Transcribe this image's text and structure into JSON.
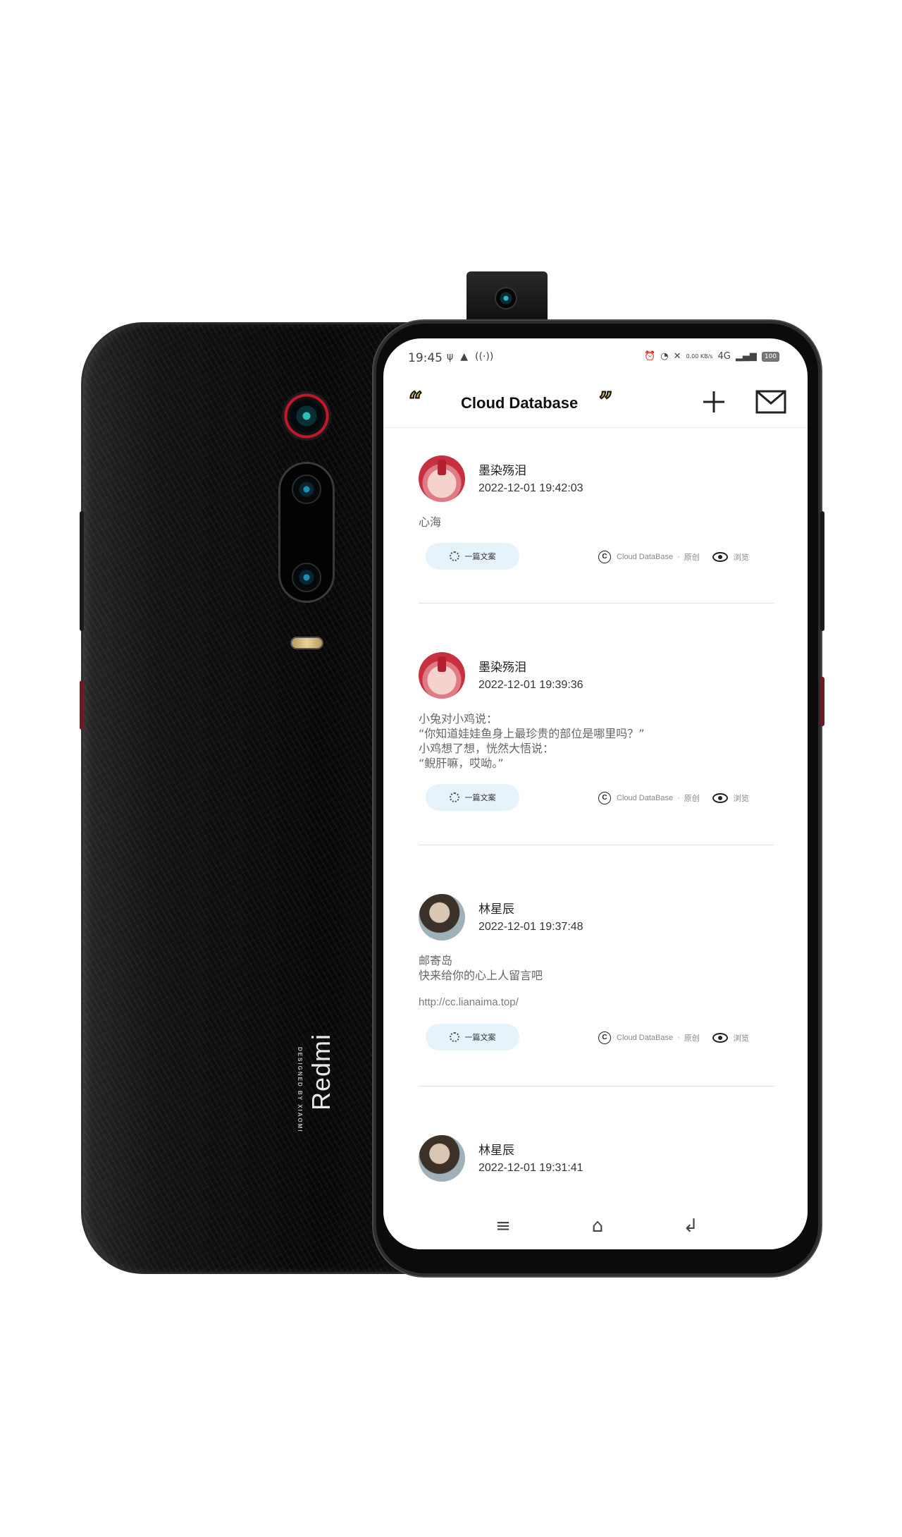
{
  "device": {
    "brand": "Redmi",
    "designed_by": "DESIGNED BY XIAOMI"
  },
  "status_bar": {
    "time": "19:45",
    "net_speed": "0.00 KB/s",
    "network": "4G",
    "battery": "100"
  },
  "header": {
    "title": "Cloud Database",
    "left_quote": "“",
    "right_quote": "”"
  },
  "posts": [
    {
      "author": "墨染殇泪",
      "time": "2022-12-01 19:42:03",
      "content": "心海",
      "link": "",
      "tag": "一篇文案",
      "source": "Cloud DataBase",
      "original": "原创",
      "views": "浏览"
    },
    {
      "author": "墨染殇泪",
      "time": "2022-12-01 19:39:36",
      "content": "小兔对小鸡说：\n“你知道娃娃鱼身上最珍贵的部位是哪里吗？”\n小鸡想了想，恍然大悟说：\n“鲵肝嘛，哎呦。”",
      "link": "",
      "tag": "一篇文案",
      "source": "Cloud DataBase",
      "original": "原创",
      "views": "浏览"
    },
    {
      "author": "林星辰",
      "time": "2022-12-01 19:37:48",
      "content": "邮寄岛\n快来给你的心上人留言吧",
      "link": "http://cc.lianaima.top/",
      "tag": "一篇文案",
      "source": "Cloud DataBase",
      "original": "原创",
      "views": "浏览"
    },
    {
      "author": "林星辰",
      "time": "2022-12-01 19:31:41"
    }
  ],
  "nav": {
    "menu": "≡",
    "home": "⌂",
    "back": "↲"
  }
}
